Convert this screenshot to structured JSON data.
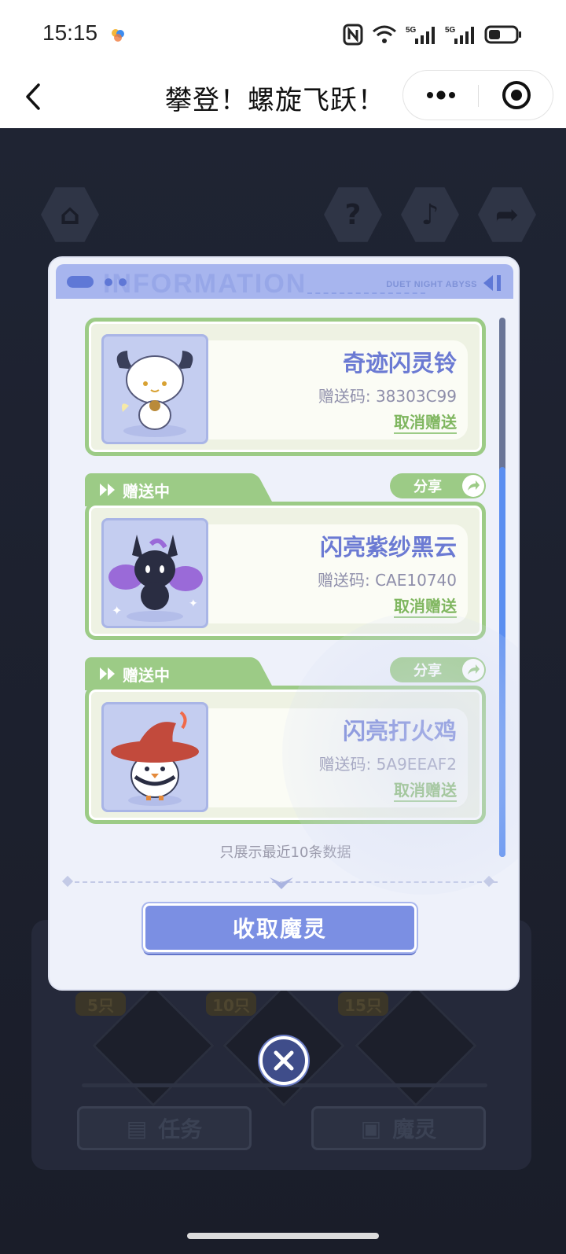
{
  "status_bar": {
    "time": "15:15"
  },
  "nav_bar": {
    "title": "攀登！螺旋飞跃！"
  },
  "background": {
    "tabs": [
      {
        "label": "任务"
      },
      {
        "label": "魔灵"
      }
    ],
    "milestones": [
      {
        "label": "5只"
      },
      {
        "label": "10只"
      },
      {
        "label": "15只"
      }
    ]
  },
  "modal": {
    "header": {
      "ghost_title": "INFORMATION",
      "brand": "DUET NIGHT ABYSS"
    },
    "items": [
      {
        "name": "奇迹闪灵铃",
        "code_label": "赠送码:",
        "code": "38303C99",
        "cancel_label": "取消赠送",
        "status": "",
        "share_label": ""
      },
      {
        "name": "闪亮紫纱黑云",
        "code_label": "赠送码:",
        "code": "CAE10740",
        "cancel_label": "取消赠送",
        "status": "赠送中",
        "share_label": "分享"
      },
      {
        "name": "闪亮打火鸡",
        "code_label": "赠送码:",
        "code": "5A9EEAF2",
        "cancel_label": "取消赠送",
        "status": "赠送中",
        "share_label": "分享"
      }
    ],
    "footnote": "只展示最近10条数据",
    "collect_button_label": "收取魔灵"
  },
  "colors": {
    "accent_green": "#9ccb86",
    "accent_blue": "#7b8fe3",
    "name_color": "#6b7ad3"
  },
  "icons": [
    "back-arrow-icon",
    "more-dots-icon",
    "target-icon",
    "home-icon",
    "help-icon",
    "music-icon",
    "share-icon",
    "close-icon",
    "play-arrows-icon",
    "share-arrow-icon",
    "collapse-arrow-icon"
  ]
}
